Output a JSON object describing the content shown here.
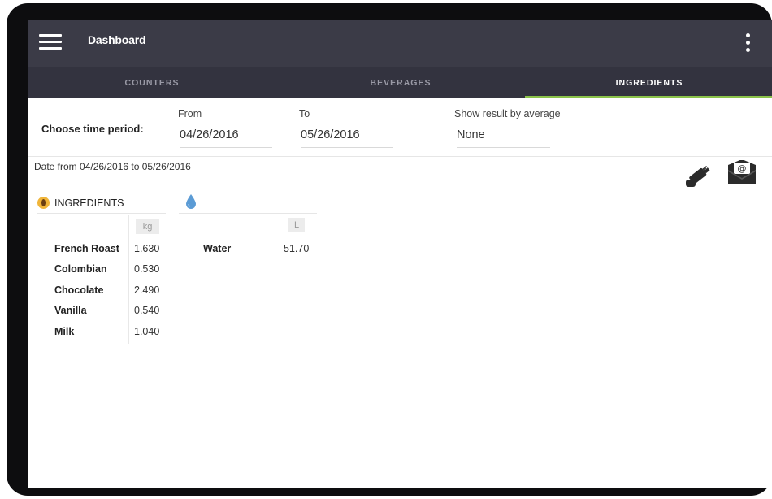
{
  "appbar": {
    "title": "Dashboard"
  },
  "tabs": [
    {
      "label": "COUNTERS",
      "active": false
    },
    {
      "label": "BEVERAGES",
      "active": false
    },
    {
      "label": "INGREDIENTS",
      "active": true
    }
  ],
  "colors": {
    "appbar": "#3b3b47",
    "tabbar": "#33333f",
    "tab_indicator": "#8bc34a",
    "coffee_icon": "#f0b53a",
    "drop_icon": "#5b9bd5"
  },
  "icons": [
    "menu-icon",
    "more-vert-icon",
    "export-icon",
    "email-icon",
    "coffee-bean-icon",
    "water-drop-icon"
  ],
  "filters": {
    "period_label": "Choose time period:",
    "from_label": "From",
    "from_value": "04/26/2016",
    "to_label": "To",
    "to_value": "05/26/2016",
    "average_label": "Show result by average",
    "average_value": "None"
  },
  "date_range_text": "Date from 04/26/2016 to 05/26/2016",
  "ingredients": {
    "title": "INGREDIENTS",
    "unit": "kg",
    "rows": [
      {
        "name": "French Roast",
        "value": "1.630"
      },
      {
        "name": "Colombian",
        "value": "0.530"
      },
      {
        "name": "Chocolate",
        "value": "2.490"
      },
      {
        "name": "Vanilla",
        "value": "0.540"
      },
      {
        "name": "Milk",
        "value": "1.040"
      }
    ]
  },
  "water": {
    "unit": "L",
    "rows": [
      {
        "name": "Water",
        "value": "51.70"
      }
    ]
  }
}
